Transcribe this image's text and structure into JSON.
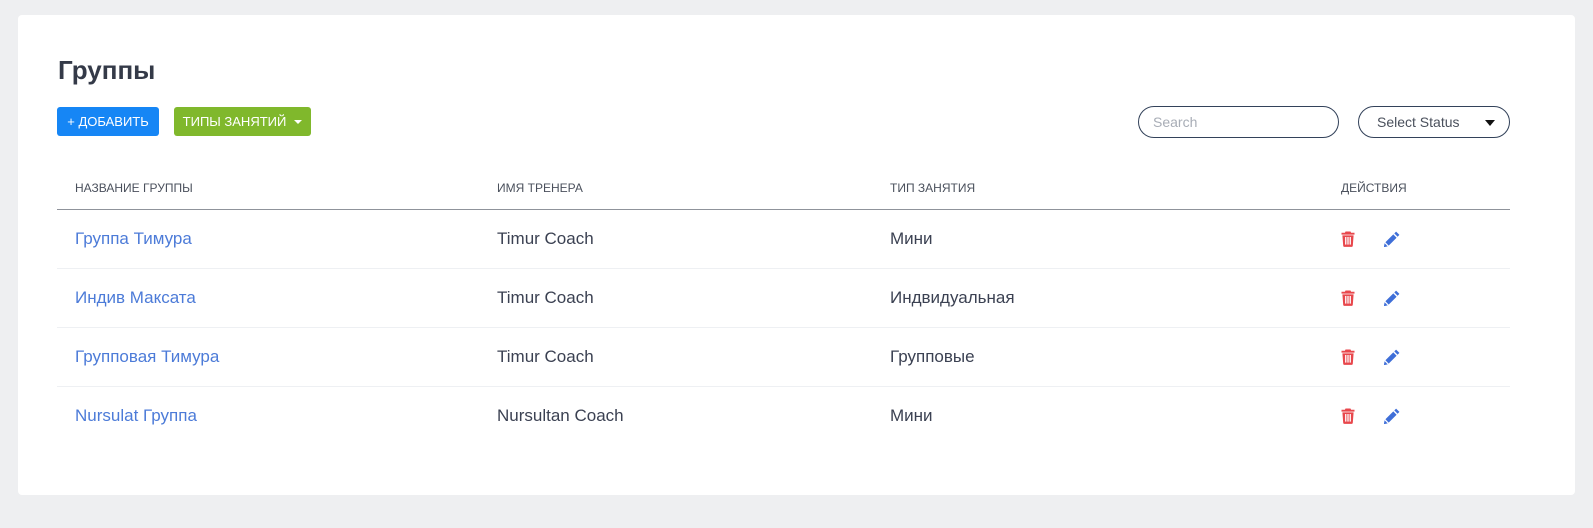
{
  "page": {
    "title": "Группы"
  },
  "toolbar": {
    "add_label": "+ ДОБАВИТЬ",
    "types_label": "ТИПЫ ЗАНЯТИЙ",
    "search_placeholder": "Search",
    "status_select_label": "Select Status"
  },
  "colors": {
    "add_button": "#1686f5",
    "types_button": "#80b82c",
    "link": "#4c7bd8",
    "delete_icon": "#e8474c",
    "edit_icon": "#3f6fd8"
  },
  "table": {
    "headers": [
      "НАЗВАНИЕ ГРУППЫ",
      "ИМЯ ТРЕНЕРА",
      "ТИП ЗАНЯТИЯ",
      "ДЕЙСТВИЯ"
    ],
    "rows": [
      {
        "name": "Группа Тимура",
        "coach": "Timur Coach",
        "type": "Мини"
      },
      {
        "name": "Индив Максата",
        "coach": "Timur Coach",
        "type": "Индвидуальная"
      },
      {
        "name": "Групповая Тимура",
        "coach": "Timur Coach",
        "type": "Групповые"
      },
      {
        "name": "Nursulat Группа",
        "coach": "Nursultan Coach",
        "type": "Мини"
      }
    ],
    "row_actions": [
      "trash-icon",
      "pencil-icon"
    ]
  }
}
